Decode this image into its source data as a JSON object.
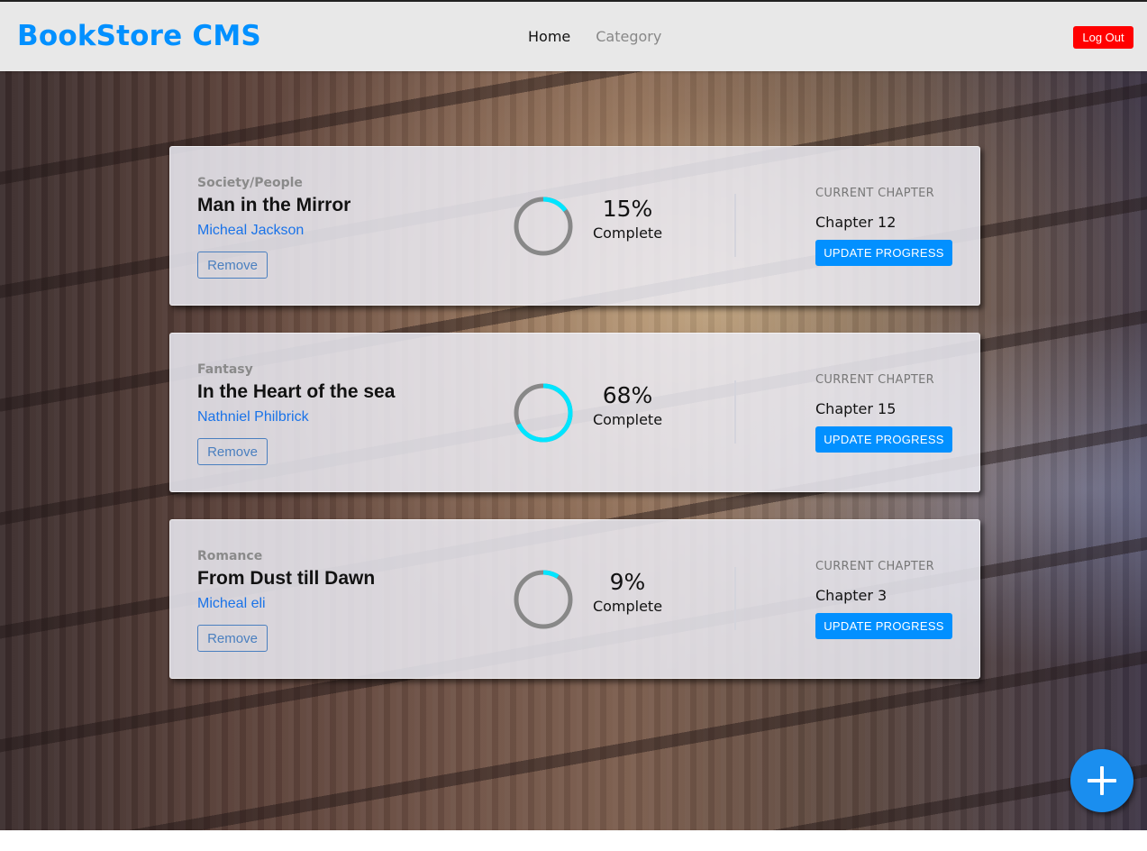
{
  "header": {
    "logo": "BookStore CMS",
    "nav": [
      {
        "label": "Home",
        "active": true
      },
      {
        "label": "Category",
        "active": false
      }
    ],
    "logout_label": "Log Out"
  },
  "books": [
    {
      "genre": "Society/People",
      "title": "Man in the Mirror",
      "author": "Micheal Jackson",
      "remove_label": "Remove",
      "progress_text": "15%",
      "progress": 0.15,
      "complete_label": "Complete",
      "current_chapter_label": "CURRENT CHAPTER",
      "chapter": "Chapter 12",
      "update_label": "UPDATE PROGRESS"
    },
    {
      "genre": "Fantasy",
      "title": "In the Heart of the sea",
      "author": "Nathniel Philbrick",
      "remove_label": "Remove",
      "progress_text": "68%",
      "progress": 0.68,
      "complete_label": "Complete",
      "current_chapter_label": "CURRENT CHAPTER",
      "chapter": "Chapter 15",
      "update_label": "UPDATE PROGRESS"
    },
    {
      "genre": "Romance",
      "title": "From Dust till Dawn",
      "author": "Micheal eli",
      "remove_label": "Remove",
      "progress_text": "9%",
      "progress": 0.09,
      "complete_label": "Complete",
      "current_chapter_label": "CURRENT CHAPTER",
      "chapter": "Chapter 3",
      "update_label": "UPDATE PROGRESS"
    }
  ],
  "fab_icon": "plus-icon",
  "colors": {
    "brand": "#0290ff",
    "logout": "#ff0000",
    "progress_fill": "#00e5ff",
    "progress_track": "#888888",
    "author_link": "#1a73e8"
  }
}
